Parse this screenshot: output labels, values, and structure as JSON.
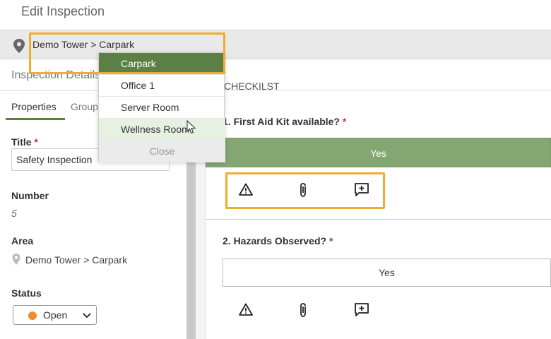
{
  "header": {
    "title": "Edit Inspection"
  },
  "location": {
    "path": "Demo Tower > Carpark"
  },
  "left_panel": {
    "section_title": "Inspection Details",
    "tabs": [
      {
        "label": "Properties"
      },
      {
        "label": "Groups"
      }
    ],
    "title_field": {
      "label": "Title",
      "value": "Safety Inspection"
    },
    "number_field": {
      "label": "Number",
      "value": "5"
    },
    "area_field": {
      "label": "Area",
      "value": "Demo Tower > Carpark"
    },
    "status_field": {
      "label": "Status",
      "value": "Open",
      "color": "#f08a2e"
    }
  },
  "checklist": {
    "title": "CHECKILST",
    "questions": [
      {
        "label": "1. First Aid Kit available?",
        "answer": "Yes"
      },
      {
        "label": "2. Hazards Observed?",
        "answer": "Yes"
      }
    ],
    "action_icons": [
      "warning-icon",
      "paperclip-icon",
      "add-comment-icon"
    ]
  },
  "dropdown": {
    "items": [
      {
        "label": "Carpark"
      },
      {
        "label": "Office 1"
      },
      {
        "label": "Server Room"
      },
      {
        "label": "Wellness Room"
      }
    ],
    "close_label": "Close"
  },
  "colors": {
    "accent_green": "#5b7f45",
    "selected_answer": "#83a672",
    "highlight": "#f0ac2c",
    "required": "#c0392b"
  }
}
